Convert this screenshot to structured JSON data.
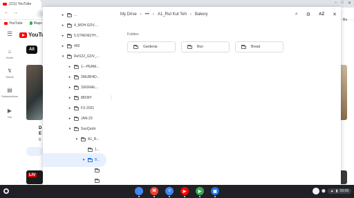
{
  "browser": {
    "tab_title": "(211) YouTube",
    "bookmarks": [
      "YouTube",
      "Maps"
    ],
    "window_controls": [
      "–",
      "□",
      "✕"
    ]
  },
  "youtube": {
    "logo_text": "YouTube",
    "sidebar": [
      {
        "icon": "⌂",
        "label": "Home"
      },
      {
        "icon": "↯",
        "label": "Shorts"
      },
      {
        "icon": "▤",
        "label": "Subscriptions"
      },
      {
        "icon": "▶",
        "label": "You"
      }
    ],
    "chip_label": "All",
    "title_fragment": "D\nE",
    "meta_fragment": "B",
    "live_badge": "LIV",
    "right_fragment": "Bo"
  },
  "drive_picker": {
    "breadcrumbs": [
      "My Drive",
      "•••",
      "A1_Rut Kut Teh",
      "Bakery"
    ],
    "tools": {
      "search": "⌕",
      "settings": "⚙",
      "sort": "AZ",
      "close": "✕"
    },
    "section_label": "Folders",
    "folders": [
      "Gardenia",
      "Bun",
      "Bread"
    ],
    "tree": [
      {
        "label": "...",
        "caret": "▸",
        "indent": 0
      },
      {
        "label": "4_MOH.GOV....",
        "caret": "▸",
        "indent": 0
      },
      {
        "label": "5.STRENGTH...",
        "caret": "▸",
        "indent": 0
      },
      {
        "label": "400",
        "caret": "▸",
        "indent": 0
      },
      {
        "label": "Ref122_GOV_...",
        "caret": "▾",
        "indent": 0
      },
      {
        "label": "1---PERM...",
        "caret": "▸",
        "indent": 1
      },
      {
        "label": "2MURHID...",
        "caret": "▸",
        "indent": 1
      },
      {
        "label": "3SIGNAL...",
        "caret": "▸",
        "indent": 1
      },
      {
        "label": "881MY",
        "caret": "▸",
        "indent": 1
      },
      {
        "label": "FX-2021",
        "caret": "▸",
        "indent": 1
      },
      {
        "label": "JAN-23",
        "caret": "▸",
        "indent": 1
      },
      {
        "label": "SunQuick",
        "caret": "▾",
        "indent": 1
      },
      {
        "label": "A1_R...",
        "caret": "▾",
        "indent": 2
      },
      {
        "label": "1...",
        "caret": "",
        "indent": 3
      },
      {
        "label": "B...",
        "caret": "▾",
        "indent": 3,
        "selected": true
      },
      {
        "label": "",
        "caret": "",
        "indent": 4
      },
      {
        "label": "",
        "caret": "",
        "indent": 4
      }
    ]
  },
  "shelf": {
    "apps": [
      {
        "name": "chrome-icon",
        "color": "#4285f4",
        "glyph": ""
      },
      {
        "name": "gmail-icon",
        "color": "#ea4335",
        "glyph": "M"
      },
      {
        "name": "docs-icon",
        "color": "#4285f4",
        "glyph": "≡"
      },
      {
        "name": "youtube-icon",
        "color": "#ff0000",
        "glyph": "▶"
      },
      {
        "name": "play-store-icon",
        "color": "#34a853",
        "glyph": "▶"
      },
      {
        "name": "files-icon",
        "color": "#1a73e8",
        "glyph": "▣"
      }
    ],
    "clock": "09:08",
    "status_icons": [
      "⬤",
      "▲",
      "▮"
    ]
  },
  "colors": {
    "selection": "#e8f0fe",
    "accent": "#1a73e8",
    "youtube_red": "#ff0000",
    "shelf": "#202124"
  }
}
